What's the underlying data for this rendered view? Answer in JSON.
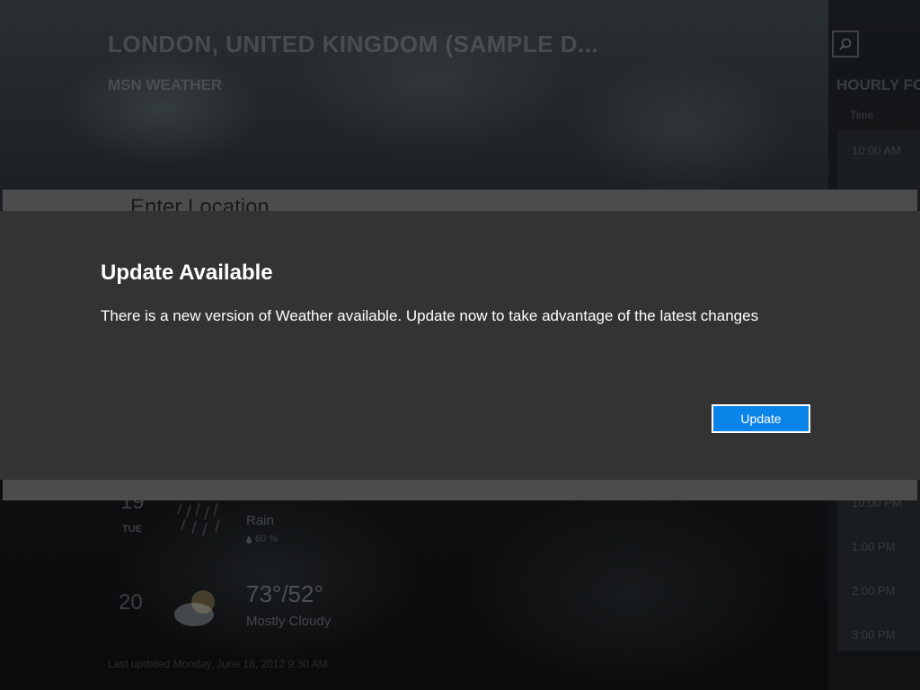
{
  "background": {
    "city_title": "LONDON, UNITED KINGDOM (SAMPLE D...",
    "app_brand": "MSN WEATHER",
    "hourly_header": "HOURLY FO",
    "hourly_time_header": "Time",
    "hourly_rows": [
      "10:00 AM",
      "10:00 PM",
      "1:00 PM",
      "2:00 PM",
      "3:00 PM"
    ],
    "forecast": [
      {
        "day": "19",
        "weekday": "TUE",
        "temp": "",
        "condition": "Rain",
        "precip": "60 %"
      },
      {
        "day": "20",
        "weekday": "",
        "temp": "73°/52°",
        "condition": "Mostly Cloudy",
        "precip": ""
      }
    ],
    "last_updated": "Last updated Monday, June 18, 2012 9:30 AM",
    "flyout_title": "Enter Location"
  },
  "dialog": {
    "title": "Update Available",
    "message": "There is a new version of Weather available. Update now to take advantage of the latest changes",
    "update_button": "Update"
  },
  "colors": {
    "dialog_bg": "#333333",
    "accent": "#0a84e8",
    "flyout_bg": "#4c4c4c"
  }
}
